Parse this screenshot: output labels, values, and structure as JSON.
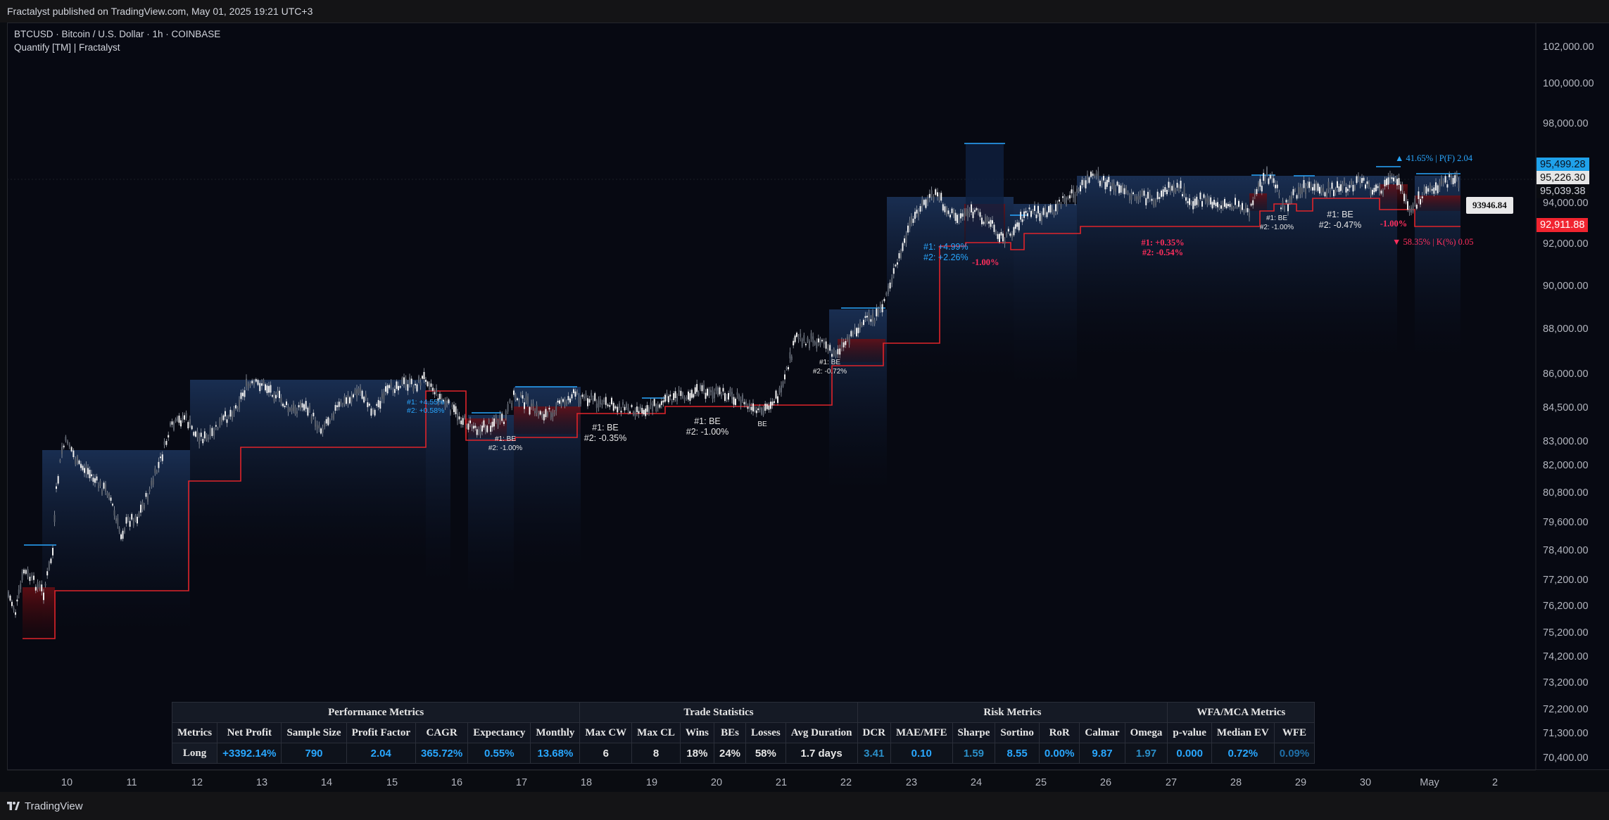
{
  "header": {
    "publish_text": "Fractalyst published on TradingView.com, May 01, 2025 19:21 UTC+3"
  },
  "legend": {
    "symbol_line": "BTCUSD · Bitcoin / U.S. Dollar · 1h · COINBASE",
    "indicator_line": "Quantify [TM] | Fractalyst"
  },
  "footer": {
    "brand": "TradingView"
  },
  "colors": {
    "accent_blue": "#29a7ff",
    "loss_red": "#ff2e5c",
    "stop_red": "#e0242a",
    "background": "#070912"
  },
  "price_axis": {
    "ticks": [
      "102,000.00",
      "100,000.00",
      "98,000.00",
      "94,000.00",
      "92,000.00",
      "90,000.00",
      "88,000.00",
      "86,000.00",
      "84,500.00",
      "83,000.00",
      "82,000.00",
      "80,800.00",
      "79,600.00",
      "78,400.00",
      "77,200.00",
      "76,200.00",
      "75,200.00",
      "74,200.00",
      "73,200.00",
      "72,200.00",
      "71,300.00",
      "70,400.00"
    ],
    "tags": {
      "target": "95,499.28",
      "last": "95,226.30",
      "mid": "95,039.38",
      "stop": "92,911.88",
      "cursor": "93946.84"
    }
  },
  "time_axis": {
    "ticks": [
      "10",
      "11",
      "12",
      "13",
      "14",
      "15",
      "16",
      "17",
      "18",
      "19",
      "20",
      "21",
      "22",
      "23",
      "24",
      "25",
      "26",
      "27",
      "28",
      "29",
      "30",
      "May",
      "2"
    ]
  },
  "chart_annotations": {
    "t1": [
      "#1: +4.55%",
      "#2: +0.58%"
    ],
    "t2": [
      "#1: BE",
      "#2: -1.00%"
    ],
    "t3": [
      "#1: BE",
      "#2: -0.35%"
    ],
    "t4": [
      "#1: BE",
      "#2: -1.00%"
    ],
    "t5": "BE",
    "t6": [
      "#1: BE",
      "#2: -0.72%"
    ],
    "t7": [
      "#1: +4.99%",
      "#2: +2.26%"
    ],
    "t8": "-1.00%",
    "t9": [
      "#1: +0.35%",
      "#2: -0.54%"
    ],
    "t10": [
      "#1: BE",
      "#2: -1.00%"
    ],
    "t11": [
      "#1: BE",
      "#2: -0.47%"
    ],
    "t12": "-1.00%",
    "prob_up": "▲ 41.65% | P(F) 2.04",
    "prob_down": "▼ 58.35% | K(%) 0.05"
  },
  "metrics": {
    "groups": [
      "Performance Metrics",
      "Trade Statistics",
      "Risk Metrics",
      "WFA/MCA Metrics"
    ],
    "headers": [
      "Metrics",
      "Net Profit",
      "Sample Size",
      "Profit Factor",
      "CAGR",
      "Expectancy",
      "Monthly",
      "Max CW",
      "Max CL",
      "Wins",
      "BEs",
      "Losses",
      "Avg Duration",
      "DCR",
      "MAE/MFE",
      "Sharpe",
      "Sortino",
      "RoR",
      "Calmar",
      "Omega",
      "p-value",
      "Median EV",
      "WFE"
    ],
    "values": [
      "Long",
      "+3392.14%",
      "790",
      "2.04",
      "365.72%",
      "0.55%",
      "13.68%",
      "6",
      "8",
      "18%",
      "24%",
      "58%",
      "1.7 days",
      "3.41",
      "0.10",
      "1.59",
      "8.55",
      "0.00%",
      "9.87",
      "1.97",
      "0.000",
      "0.72%",
      "0.09%"
    ]
  }
}
